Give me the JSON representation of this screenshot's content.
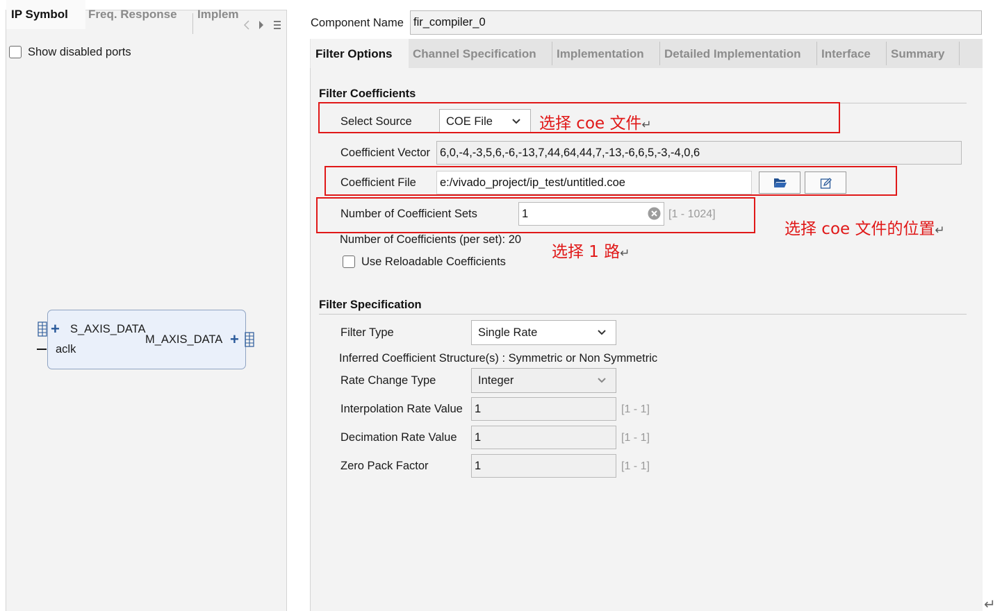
{
  "left_panel": {
    "tabs": [
      "IP Symbol",
      "Freq. Response",
      "Implem"
    ],
    "show_disabled_ports": "Show disabled ports",
    "ip_block": {
      "port_s_axis": "S_AXIS_DATA",
      "port_m_axis": "M_AXIS_DATA",
      "port_aclk": "aclk"
    }
  },
  "component": {
    "label": "Component Name",
    "value": "fir_compiler_0"
  },
  "tabs": [
    "Filter Options",
    "Channel Specification",
    "Implementation",
    "Detailed Implementation",
    "Interface",
    "Summary"
  ],
  "filter_coefficients": {
    "title": "Filter Coefficients",
    "select_source_label": "Select Source",
    "select_source_value": "COE File",
    "coefficient_vector_label": "Coefficient Vector",
    "coefficient_vector_value": "6,0,-4,-3,5,6,-6,-13,7,44,64,44,7,-13,-6,6,5,-3,-4,0,6",
    "coefficient_file_label": "Coefficient File",
    "coefficient_file_value": "e:/vivado_project/ip_test/untitled.coe",
    "num_sets_label": "Number of Coefficient Sets",
    "num_sets_value": "1",
    "num_sets_range": "[1 - 1024]",
    "num_coefficients": "Number of Coefficients (per set): 20",
    "reloadable_label": "Use Reloadable Coefficients"
  },
  "filter_specification": {
    "title": "Filter Specification",
    "filter_type_label": "Filter Type",
    "filter_type_value": "Single Rate",
    "inferred_structure": "Inferred Coefficient Structure(s) : Symmetric or Non Symmetric",
    "rate_change_label": "Rate Change Type",
    "rate_change_value": "Integer",
    "interp_label": "Interpolation Rate Value",
    "interp_value": "1",
    "interp_range": "[1 - 1]",
    "decim_label": "Decimation Rate Value",
    "decim_value": "1",
    "decim_range": "[1 - 1]",
    "zero_pack_label": "Zero Pack Factor",
    "zero_pack_value": "1",
    "zero_pack_range": "[1 - 1]"
  },
  "annotations": {
    "select_coe": "选择 coe 文件",
    "coe_location": "选择 coe 文件的位置",
    "one_path": "选择 1 路",
    "return_mark": "↵"
  },
  "colors": {
    "annotation_red": "#e01818",
    "port_blue": "#2a5a9a"
  }
}
